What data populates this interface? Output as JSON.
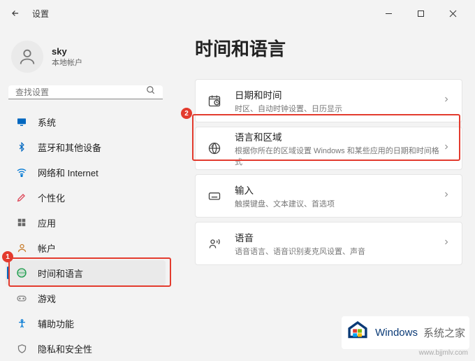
{
  "titlebar": {
    "title": "设置"
  },
  "user": {
    "name": "sky",
    "subtitle": "本地帐户"
  },
  "search": {
    "placeholder": "查找设置"
  },
  "nav": {
    "items": [
      {
        "label": "系统"
      },
      {
        "label": "蓝牙和其他设备"
      },
      {
        "label": "网络和 Internet"
      },
      {
        "label": "个性化"
      },
      {
        "label": "应用"
      },
      {
        "label": "帐户"
      },
      {
        "label": "时间和语言"
      },
      {
        "label": "游戏"
      },
      {
        "label": "辅助功能"
      },
      {
        "label": "隐私和安全性"
      }
    ]
  },
  "page": {
    "title": "时间和语言"
  },
  "cards": [
    {
      "title": "日期和时间",
      "subtitle": "时区、自动时钟设置、日历显示"
    },
    {
      "title": "语言和区域",
      "subtitle": "根据你所在的区域设置 Windows 和某些应用的日期和时间格式"
    },
    {
      "title": "输入",
      "subtitle": "触摸键盘、文本建议、首选项"
    },
    {
      "title": "语音",
      "subtitle": "语音语言、语音识别麦克风设置、声音"
    }
  ],
  "annotations": {
    "badge1": "1",
    "badge2": "2"
  },
  "watermark": {
    "brand": "Windows",
    "suffix": "系统之家",
    "url": "www.bjjmlv.com"
  },
  "colors": {
    "accent": "#0067c0",
    "highlight": "#e33b2e"
  }
}
